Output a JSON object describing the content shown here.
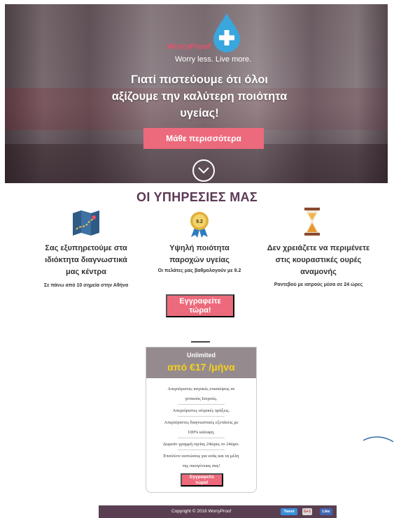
{
  "hero": {
    "logo_name": "WorryProof",
    "tagline": "Worry less. Live more.",
    "title_lines": [
      "Γιατί πιστεύουμε ότι όλοι",
      "αξίζουμε την καλύτερη ποιότητα",
      "υγείας!"
    ],
    "button_label": "Μάθε περισσότερα"
  },
  "services": {
    "title": "ΟΙ ΥΠΗΡΕΣΙΕΣ ΜΑΣ",
    "items": [
      {
        "icon": "map-icon",
        "title_lines": [
          "Σας εξυπηρετούμε στα",
          "ιδιόκτητα διαγνωστικά",
          "μας κέντρα"
        ],
        "subtitle": "Σε πάνω από 10 σημεία στην Αθήνα"
      },
      {
        "icon": "award-badge-icon",
        "badge_value": "9.2",
        "title_lines": [
          "Υψηλή ποιότητα",
          "παροχών υγείας"
        ],
        "subtitle": "Οι πελάτες μας βαθμολογούν με 9.2"
      },
      {
        "icon": "hourglass-icon",
        "title_lines": [
          "Δεν χρειάζετε να περιμένετε",
          "στις κουραστικές ουρές",
          "αναμονής"
        ],
        "subtitle": "Ραντεβού με ιατρούς μέσα σε 24 ώρες"
      }
    ],
    "cta_lines": [
      "Εγγραφείτε",
      "τώρα!"
    ]
  },
  "pricing": {
    "plan": "Unlimited",
    "price": "από €17 /μήνα",
    "features": [
      "Απεριόριστες ιατρικές επισκέψεις σε",
      "γενικούς Ιατρούς.",
      "Απεριόριστες ιατρικές πράξεις.",
      "Απεριόριστες διαγνωστικές εξετάσεις με",
      "100% κάλυψη.",
      "Δωρεάν γραμμή υγείας 24ώρες το 24ώρο.",
      "Επιπλέον εκπτώσεις για εσάς και τα μέλη",
      "της οικογένειας σας!"
    ],
    "button_lines": [
      "Εγγραφείτε",
      "τώρα!"
    ]
  },
  "footer": {
    "copyright": "Copyright © 2016 WorryProof",
    "tweet": "Tweet",
    "gplus": "G+1",
    "like": "Like"
  },
  "colors": {
    "accent": "#ec6a7b",
    "title": "#5c3a56",
    "price": "#f7d21b",
    "card_header": "#958b8f",
    "footer": "#5a3f52"
  }
}
